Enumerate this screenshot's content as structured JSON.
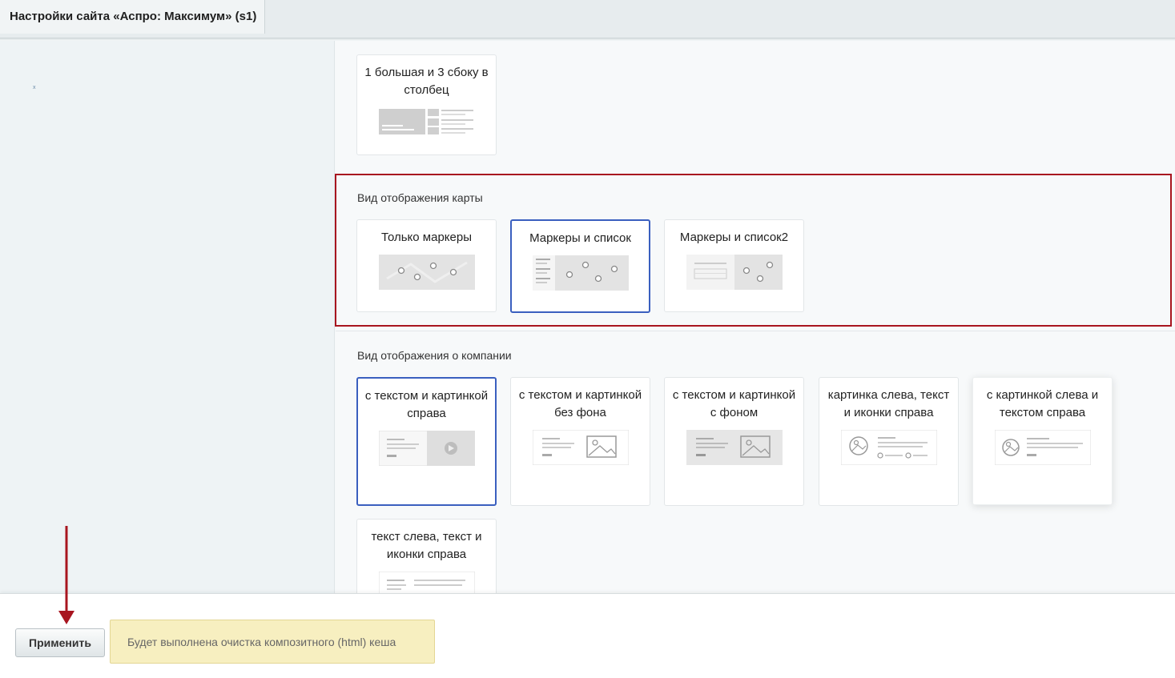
{
  "window": {
    "title": "Настройки сайта «Аспро: Максимум» (s1)"
  },
  "left_panel": {
    "mark": "х"
  },
  "top_option": {
    "label": "1 большая и 3 сбоку в столбец"
  },
  "map_section": {
    "title": "Вид отображения карты",
    "options": [
      {
        "label": "Только маркеры",
        "selected": false
      },
      {
        "label": "Маркеры и список",
        "selected": true
      },
      {
        "label": "Маркеры и список2",
        "selected": false
      }
    ]
  },
  "company_section": {
    "title": "Вид отображения о компании",
    "options": [
      {
        "label": "с текстом и картинкой справа",
        "selected": true
      },
      {
        "label": "с текстом и картинкой без фона",
        "selected": false
      },
      {
        "label": "с текстом и картинкой с фоном",
        "selected": false
      },
      {
        "label": "картинка слева, текст и иконки справа",
        "selected": false
      },
      {
        "label": "с картинкой слева и текстом справа",
        "selected": false
      },
      {
        "label": "текст слева, текст и иконки справа",
        "selected": false
      }
    ]
  },
  "footer": {
    "apply_label": "Применить",
    "notice": "Будет выполнена очистка композитного (html) кеша"
  },
  "colors": {
    "selected_border": "#3a5fbf",
    "highlight_border": "#a8151f",
    "notice_bg": "#f7efc0"
  }
}
